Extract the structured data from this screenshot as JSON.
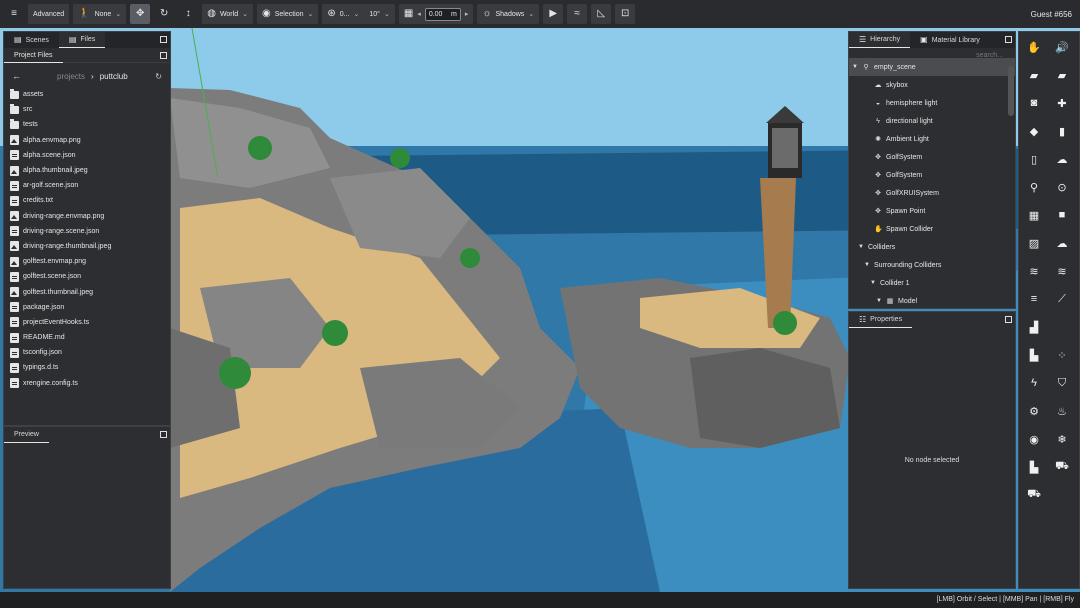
{
  "toolbar": {
    "advanced": "Advanced",
    "transform_mode": "None",
    "space": "World",
    "pivot": "Selection",
    "rotation_snap": "0...",
    "angle_snap": "10°",
    "grid_value": "0.00",
    "grid_unit": "m",
    "shadows": "Shadows",
    "user": "Guest #656"
  },
  "left_panel": {
    "tabs": [
      {
        "label": "Scenes"
      },
      {
        "label": "Files"
      }
    ],
    "subtab": "Project Files",
    "breadcrumb": {
      "root": "projects",
      "sep": "›",
      "current": "puttclub"
    },
    "files": [
      {
        "name": "assets",
        "type": "folder"
      },
      {
        "name": "src",
        "type": "folder"
      },
      {
        "name": "tests",
        "type": "folder"
      },
      {
        "name": "alpha.envmap.png",
        "type": "image"
      },
      {
        "name": "alpha.scene.json",
        "type": "doc"
      },
      {
        "name": "alpha.thumbnail.jpeg",
        "type": "image"
      },
      {
        "name": "ar-golf.scene.json",
        "type": "doc"
      },
      {
        "name": "credits.txt",
        "type": "doc"
      },
      {
        "name": "driving-range.envmap.png",
        "type": "image"
      },
      {
        "name": "driving-range.scene.json",
        "type": "doc"
      },
      {
        "name": "driving-range.thumbnail.jpeg",
        "type": "image"
      },
      {
        "name": "golftest.envmap.png",
        "type": "image"
      },
      {
        "name": "golftest.scene.json",
        "type": "doc"
      },
      {
        "name": "golftest.thumbnail.jpeg",
        "type": "image"
      },
      {
        "name": "package.json",
        "type": "doc"
      },
      {
        "name": "projectEventHooks.ts",
        "type": "doc"
      },
      {
        "name": "README.md",
        "type": "doc"
      },
      {
        "name": "tsconfig.json",
        "type": "doc"
      },
      {
        "name": "typings.d.ts",
        "type": "doc"
      },
      {
        "name": "xrengine.config.ts",
        "type": "doc"
      }
    ],
    "preview_tab": "Preview"
  },
  "hierarchy": {
    "tabs": [
      {
        "label": "Hierarchy"
      },
      {
        "label": "Material Library"
      }
    ],
    "search_placeholder": "search...",
    "nodes": [
      {
        "label": "empty_scene",
        "tri": "▼",
        "icon": "⚲",
        "depth": 0
      },
      {
        "label": "skybox",
        "tri": "",
        "icon": "☁",
        "depth": 2
      },
      {
        "label": "hemisphere light",
        "tri": "",
        "icon": "◒",
        "depth": 2
      },
      {
        "label": "directional light",
        "tri": "",
        "icon": "ϟ",
        "depth": 2
      },
      {
        "label": "Ambient Light",
        "tri": "",
        "icon": "✺",
        "depth": 2
      },
      {
        "label": "GolfSystem",
        "tri": "",
        "icon": "✥",
        "depth": 2
      },
      {
        "label": "GolfSystem",
        "tri": "",
        "icon": "✥",
        "depth": 2
      },
      {
        "label": "GolfXRUISystem",
        "tri": "",
        "icon": "✥",
        "depth": 2
      },
      {
        "label": "Spawn Point",
        "tri": "",
        "icon": "✥",
        "depth": 2
      },
      {
        "label": "Spawn Collider",
        "tri": "",
        "icon": "✋",
        "depth": 2
      },
      {
        "label": "Colliders",
        "tri": "▼",
        "icon": "",
        "depth": 1
      },
      {
        "label": "Surrounding Colliders",
        "tri": "▼",
        "icon": "",
        "depth": 2
      },
      {
        "label": "Collider 1",
        "tri": "▼",
        "icon": "",
        "depth": 3
      },
      {
        "label": "Model",
        "tri": "▼",
        "icon": "▦",
        "depth": 4
      }
    ]
  },
  "properties": {
    "tab": "Properties",
    "empty": "No node selected"
  },
  "status_bar": "[LMB] Orbit / Select | [MMB] Pan | [RMB] Fly"
}
